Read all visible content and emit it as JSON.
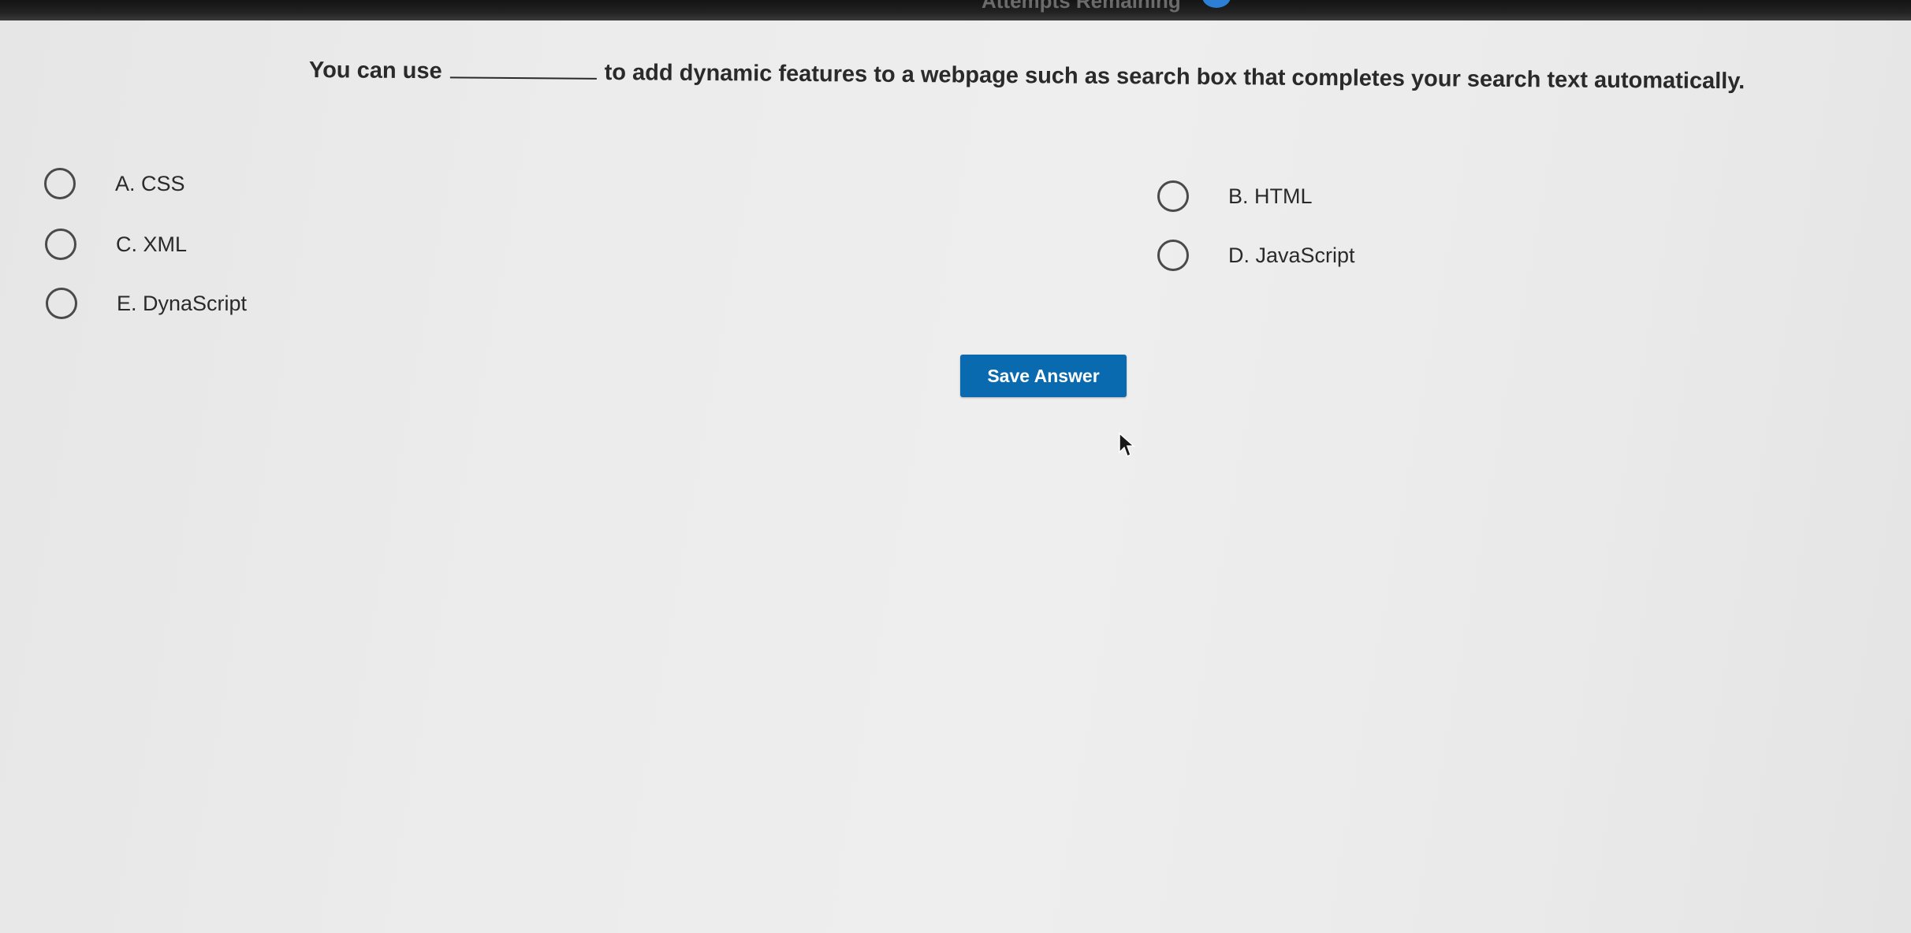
{
  "header": {
    "status_text": "Attempts Remaining"
  },
  "question": {
    "prefix": "You can use",
    "suffix": "to add dynamic features to a webpage such as search box that completes your search text automatically."
  },
  "options": [
    {
      "label": "A. CSS"
    },
    {
      "label": "B. HTML"
    },
    {
      "label": "C. XML"
    },
    {
      "label": "D. JavaScript"
    },
    {
      "label": "E. DynaScript"
    }
  ],
  "actions": {
    "save_label": "Save Answer"
  },
  "icons": {
    "radio": "radio-unchecked-icon",
    "cursor": "mouse-pointer-icon"
  },
  "colors": {
    "primary_button": "#0a6ab0",
    "badge": "#2d7fd6"
  }
}
